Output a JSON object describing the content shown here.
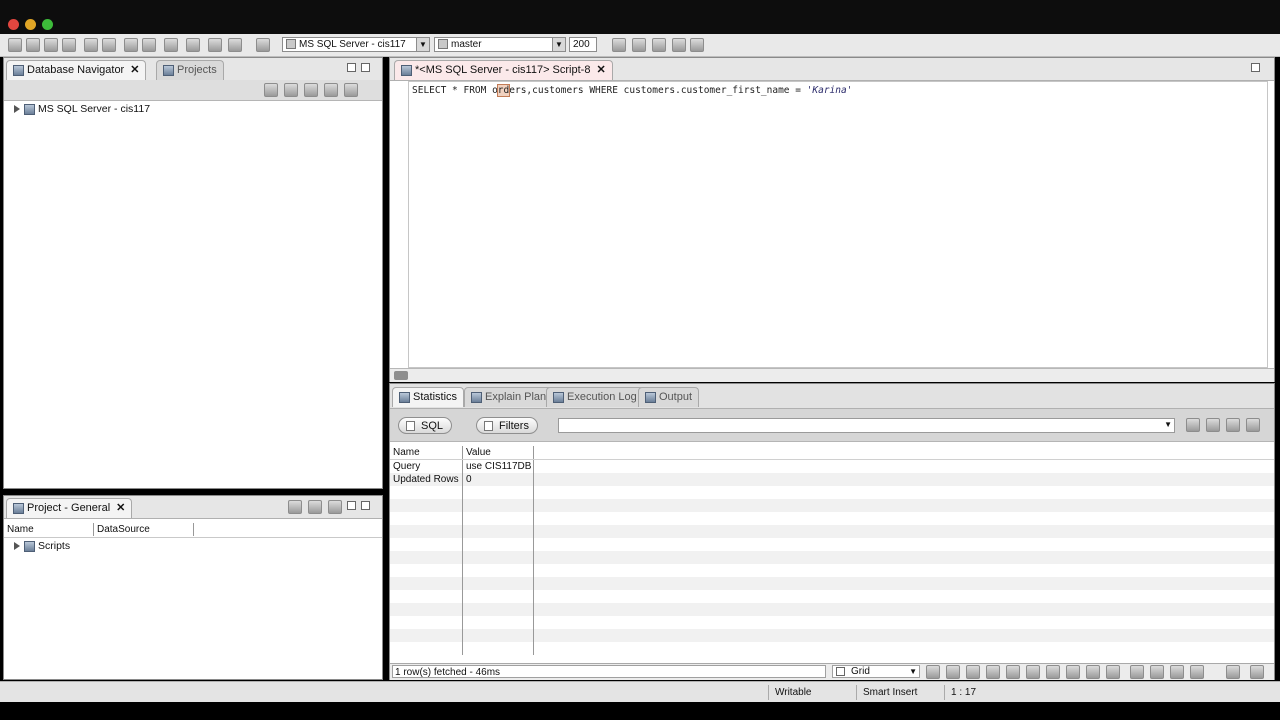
{
  "toolbar": {
    "connection": "MS SQL Server - cis117",
    "database": "master",
    "limit": "200"
  },
  "navigator": {
    "tab_label": "Database Navigator",
    "tab2_label": "Projects",
    "tree": [
      "MS SQL Server - cis117"
    ]
  },
  "project": {
    "tab_label": "Project - General",
    "columns": [
      "Name",
      "DataSource"
    ],
    "tree": [
      "Scripts"
    ]
  },
  "editor": {
    "tab_label": "*<MS SQL Server - cis117> Script-8",
    "sql_kw1": "SELECT * FROM o",
    "sql_cursor": "rd",
    "sql_mid": "ers,customers WHERE customers.customer_first_name = ",
    "sql_str": "'Karina'"
  },
  "results": {
    "tabs": [
      "Statistics",
      "Explain Plan",
      "Execution Log",
      "Output"
    ],
    "sql_button": "SQL",
    "filters_button": "Filters",
    "columns": [
      "Name",
      "Value"
    ],
    "rows": [
      {
        "name": "Query",
        "value": "use CIS117DB"
      },
      {
        "name": "Updated Rows",
        "value": "0"
      }
    ],
    "status": "1 row(s) fetched - 46ms",
    "view_mode": "Grid"
  },
  "statusbar": {
    "items": [
      "Writable",
      "Smart Insert",
      "1 : 17"
    ]
  }
}
